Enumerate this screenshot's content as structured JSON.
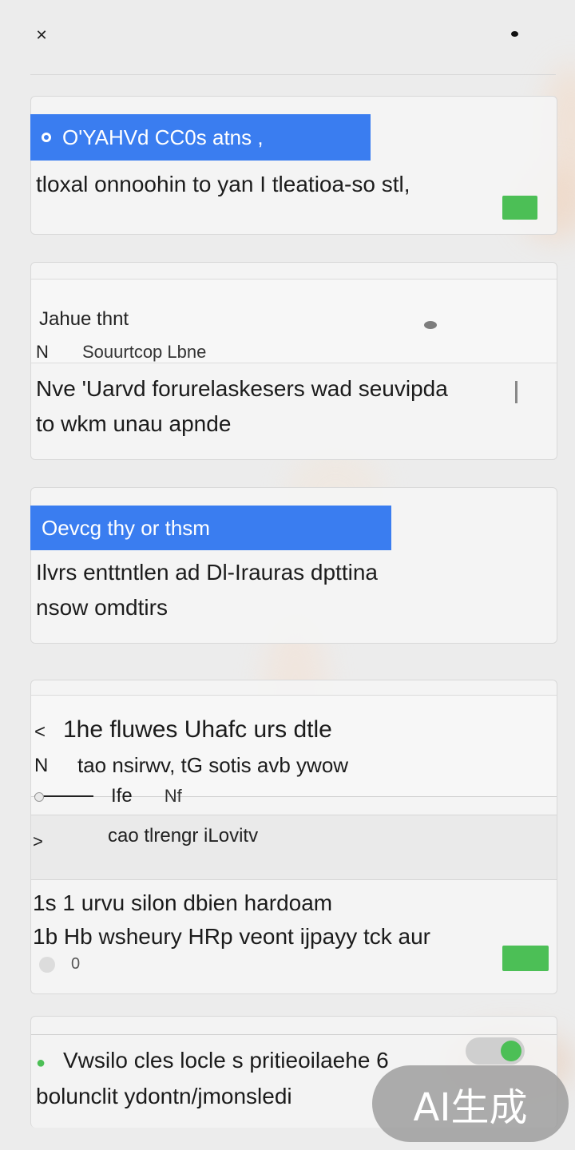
{
  "topbar": {
    "close_glyph": "✕"
  },
  "card1": {
    "banner": "O'YAHVd CC0s atns ,",
    "body": "tloxal onnoohin to yan I tleatioa-so stl,",
    "action_color": "#4cbf56"
  },
  "card2": {
    "author": "Jahue thnt",
    "subtitle": "Souurtcop Lbne",
    "subtitle_icon": "N",
    "desc_line1": "Nve 'Uarvd forurelaskesers wad seuvipda",
    "desc_line2": "to wkm unau apnde"
  },
  "card3": {
    "banner": "Oevcg thy or thsm",
    "body_line1": "Ilvrs enttntlen ad Dl-Irauras dpttina",
    "body_line2": "nsow omdtirs"
  },
  "card4": {
    "back_glyph": "<",
    "title": "1he fluwes Uhafc urs dtle",
    "meta_icon": "N",
    "meta": "tao nsirwv, tG  sotis avb ywow",
    "slider_label": "Ife",
    "slider_extra": "Nf",
    "row_chevron": ">",
    "row_label": "cao tlrengr iLovitv",
    "lower_line1": "1s 1 urvu silon dbien hardoam",
    "lower_line2": "1b Hb wsheury HRp veont ijpayy tck aur",
    "lower_small": "0",
    "action_color": "#4cbf56"
  },
  "card5": {
    "lead_icon": "●",
    "line1": "Vwsilo cles locle s pritieoilaehe 6",
    "line2": "bolunclit ydontn/jmonsledi"
  },
  "badge": {
    "text": "AI生成"
  }
}
